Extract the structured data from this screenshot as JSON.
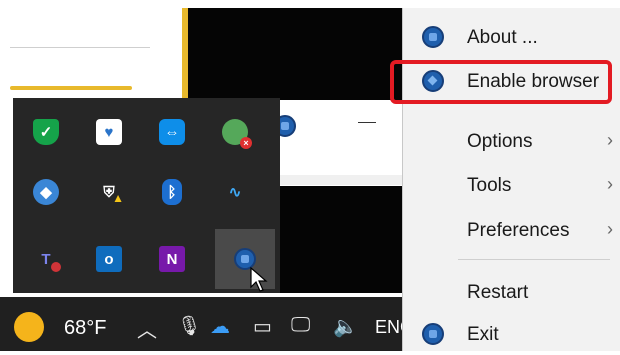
{
  "menu": {
    "items": [
      {
        "label": "About ...",
        "icon": "app-circle-icon",
        "has_submenu": false
      },
      {
        "label": "Enable browser",
        "icon": "app-diamond-icon",
        "has_submenu": false
      },
      {
        "label": "Options",
        "has_submenu": true
      },
      {
        "label": "Tools",
        "has_submenu": true
      },
      {
        "label": "Preferences",
        "has_submenu": true
      },
      {
        "label": "Restart",
        "has_submenu": false
      },
      {
        "label": "Exit",
        "icon": "app-circle-icon",
        "has_submenu": false
      }
    ],
    "submenu_arrow": "›",
    "highlight_color": "#e31b23"
  },
  "taskbar": {
    "weather_temp": "68°F",
    "language": "ENG",
    "icons": [
      "chevron-up-icon",
      "microphone-icon",
      "onedrive-icon",
      "battery-icon",
      "network-icon",
      "volume-icon"
    ]
  },
  "tray_overflow": {
    "icons": [
      "shield-check-icon",
      "vpn-shield-icon",
      "teamviewer-icon",
      "sync-error-icon",
      "network-globe-icon",
      "security-warning-icon",
      "bluetooth-icon",
      "pulse-check-icon",
      "teams-icon",
      "outlook-icon",
      "onenote-icon",
      "app-circle-icon"
    ]
  }
}
